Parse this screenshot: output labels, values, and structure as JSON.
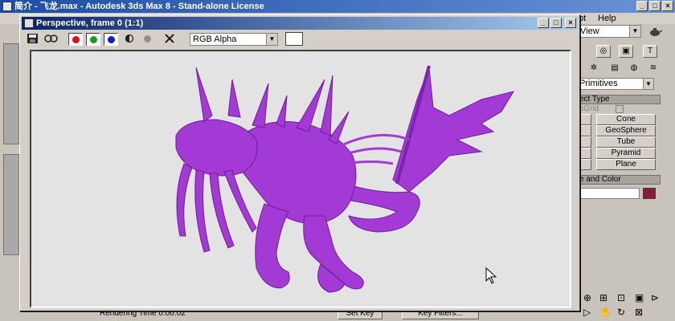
{
  "main_window": {
    "title": "简介 - 飞龙.max - Autodesk 3ds Max 8  - Stand-alone License",
    "menu_visible": [
      "pt",
      "Help"
    ]
  },
  "frame_window": {
    "title": "Perspective, frame 0 (1:1)",
    "channel": "RGB Alpha"
  },
  "command_panel": {
    "view_label": "View",
    "primitives_label": "Primitives",
    "object_type_header": "ect Type",
    "autogrid_label": "toGrid",
    "object_buttons": [
      "Cone",
      "GeoSphere",
      "Tube",
      "Pyramid",
      "Plane"
    ],
    "name_color_header": "e and Color"
  },
  "status": {
    "rendering_time": "Rendering Time  0:00:02",
    "set_key": "Set Key",
    "key_filters": "Key Filters..."
  },
  "colors": {
    "creature": "#a43ad6",
    "object_color": "#8b1a3c",
    "title_active": "#0a246a"
  }
}
